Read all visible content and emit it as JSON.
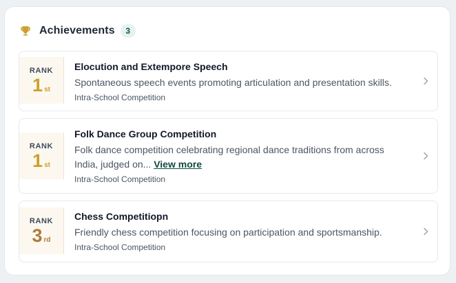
{
  "header": {
    "title": "Achievements",
    "count": "3",
    "icon": "trophy-icon"
  },
  "colors": {
    "gold": "#c9a12c",
    "bronze": "#b0793e",
    "link": "#0f4a3f"
  },
  "achievements": [
    {
      "rank_label": "RANK",
      "rank_number": "1",
      "rank_suffix": "st",
      "title": "Elocution and Extempore Speech",
      "description": "Spontaneous speech events promoting articulation and presentation skills.",
      "type": "Intra-School Competition"
    },
    {
      "rank_label": "RANK",
      "rank_number": "1",
      "rank_suffix": "st",
      "title": "Folk Dance Group Competition",
      "description": "Folk dance competition celebrating regional dance traditions from across India, judged on...",
      "view_more": "View more",
      "type": "Intra-School Competition"
    },
    {
      "rank_label": "RANK",
      "rank_number": "3",
      "rank_suffix": "rd",
      "title": "Chess Competitiopn",
      "description": "Friendly chess competition focusing on participation and sportsmanship.",
      "type": "Intra-School Competition"
    }
  ]
}
